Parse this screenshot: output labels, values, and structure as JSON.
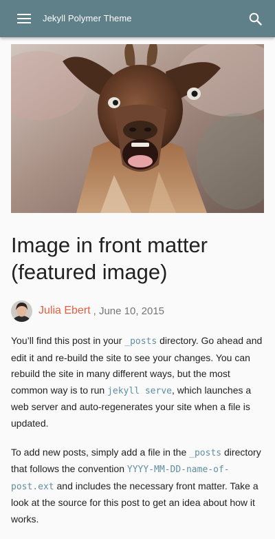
{
  "header": {
    "site_title": "Jekyll Polymer Theme",
    "menu_icon": "menu-icon",
    "search_icon": "search-icon",
    "bar_color": "#5f7f89"
  },
  "post": {
    "featured_image": "goat-photo",
    "title": "Image in front matter (featured image)",
    "author": "Julia Ebert",
    "date_separator": " , ",
    "date": "June 10, 2015",
    "author_color": "#e85d3f"
  },
  "body": {
    "p1": {
      "t1": "You’ll find this post in your ",
      "c1": "_posts",
      "t2": " directory. Go ahead and edit it and re-build the site to see your changes. You can rebuild the site in many different ways, but the most common way is to run ",
      "c2": "jekyll serve",
      "t3": ", which launches a web server and auto-regenerates your site when a file is updated."
    },
    "p2": {
      "t1": "To add new posts, simply add a file in the ",
      "c1": "_posts",
      "t2": " directory that follows the convention ",
      "c2": "YYYY-MM-DD-name-of-post.ext",
      "t3": " and includes the necessary front matter. Take a look at the source for this post to get an idea about how it works."
    }
  }
}
